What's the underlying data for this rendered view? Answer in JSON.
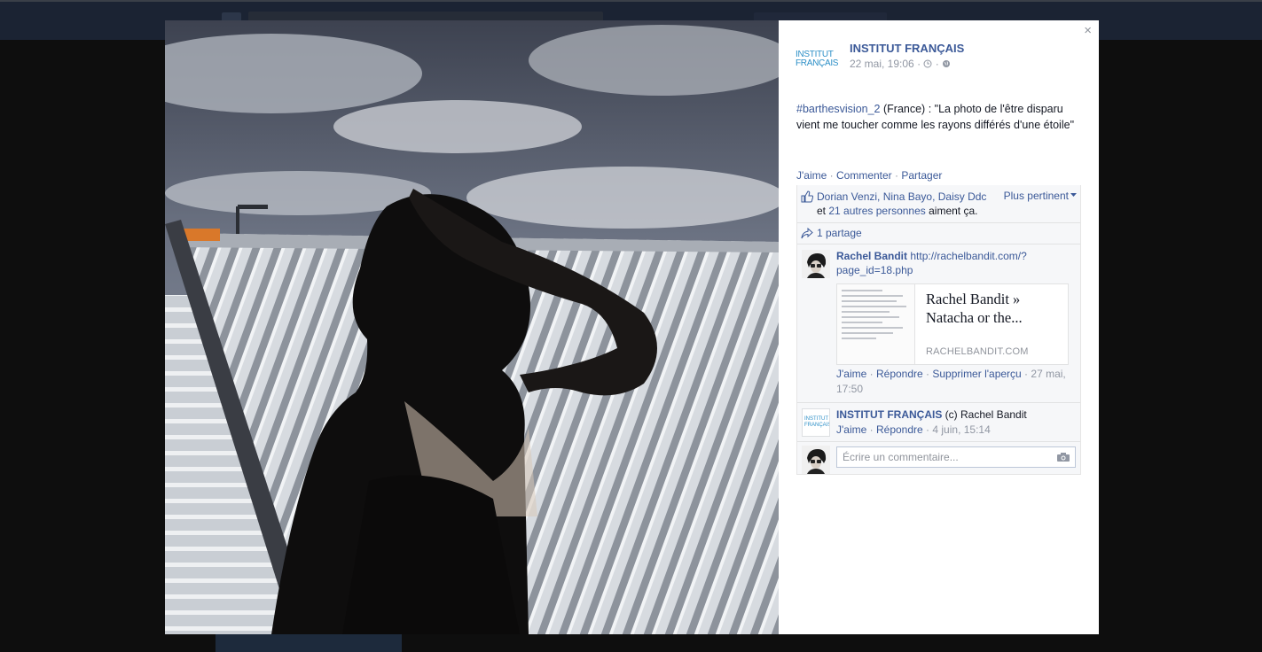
{
  "post": {
    "page_name": "INSTITUT FRANÇAIS",
    "logo_text": "INSTITUT FRANÇAIS",
    "date": "22 mai, 19:06",
    "meta_sep": "·",
    "hashtag": "#barthesvision_2",
    "text": " (France) : \"La photo de l'être disparu vient me toucher comme les rayons différés d'une étoile\""
  },
  "actions": {
    "like": "J'aime",
    "comment": "Commenter",
    "share": "Partager",
    "sep": " · "
  },
  "likes": {
    "names": "Dorian Venzi, Nina Bayo, Daisy Ddc",
    "and": "et",
    "others": "21 autres personnes",
    "suffix": "aiment ça.",
    "sort_label": "Plus pertinent"
  },
  "shares": {
    "label": "1 partage"
  },
  "comments": [
    {
      "author": "Rachel Bandit",
      "text": "http://rachelbandit.com/?page_id=18.php",
      "preview": {
        "title": "Rachel Bandit » Natacha or the...",
        "domain": "RACHELBANDIT.COM"
      },
      "like": "J'aime",
      "reply": "Répondre",
      "remove_preview": "Supprimer l'aperçu",
      "time": "27 mai, 17:50"
    },
    {
      "author": "INSTITUT FRANÇAIS",
      "text": "(c) Rachel Bandit",
      "like": "J'aime",
      "reply": "Répondre",
      "time": "4 juin, 15:14",
      "avatar_text": "INSTITUT FRANÇAIS"
    }
  ],
  "reply": {
    "placeholder": "Écrire un commentaire..."
  },
  "close": "×",
  "colors": {
    "link": "#3b5998",
    "muted": "#9197a3",
    "ufi_bg": "#f6f7f9",
    "overlay": "#0e0e0e"
  },
  "icons": [
    "close-icon",
    "clock-icon",
    "globe-icon",
    "like-icon",
    "share-icon",
    "camera-icon",
    "dropdown-caret-icon"
  ]
}
